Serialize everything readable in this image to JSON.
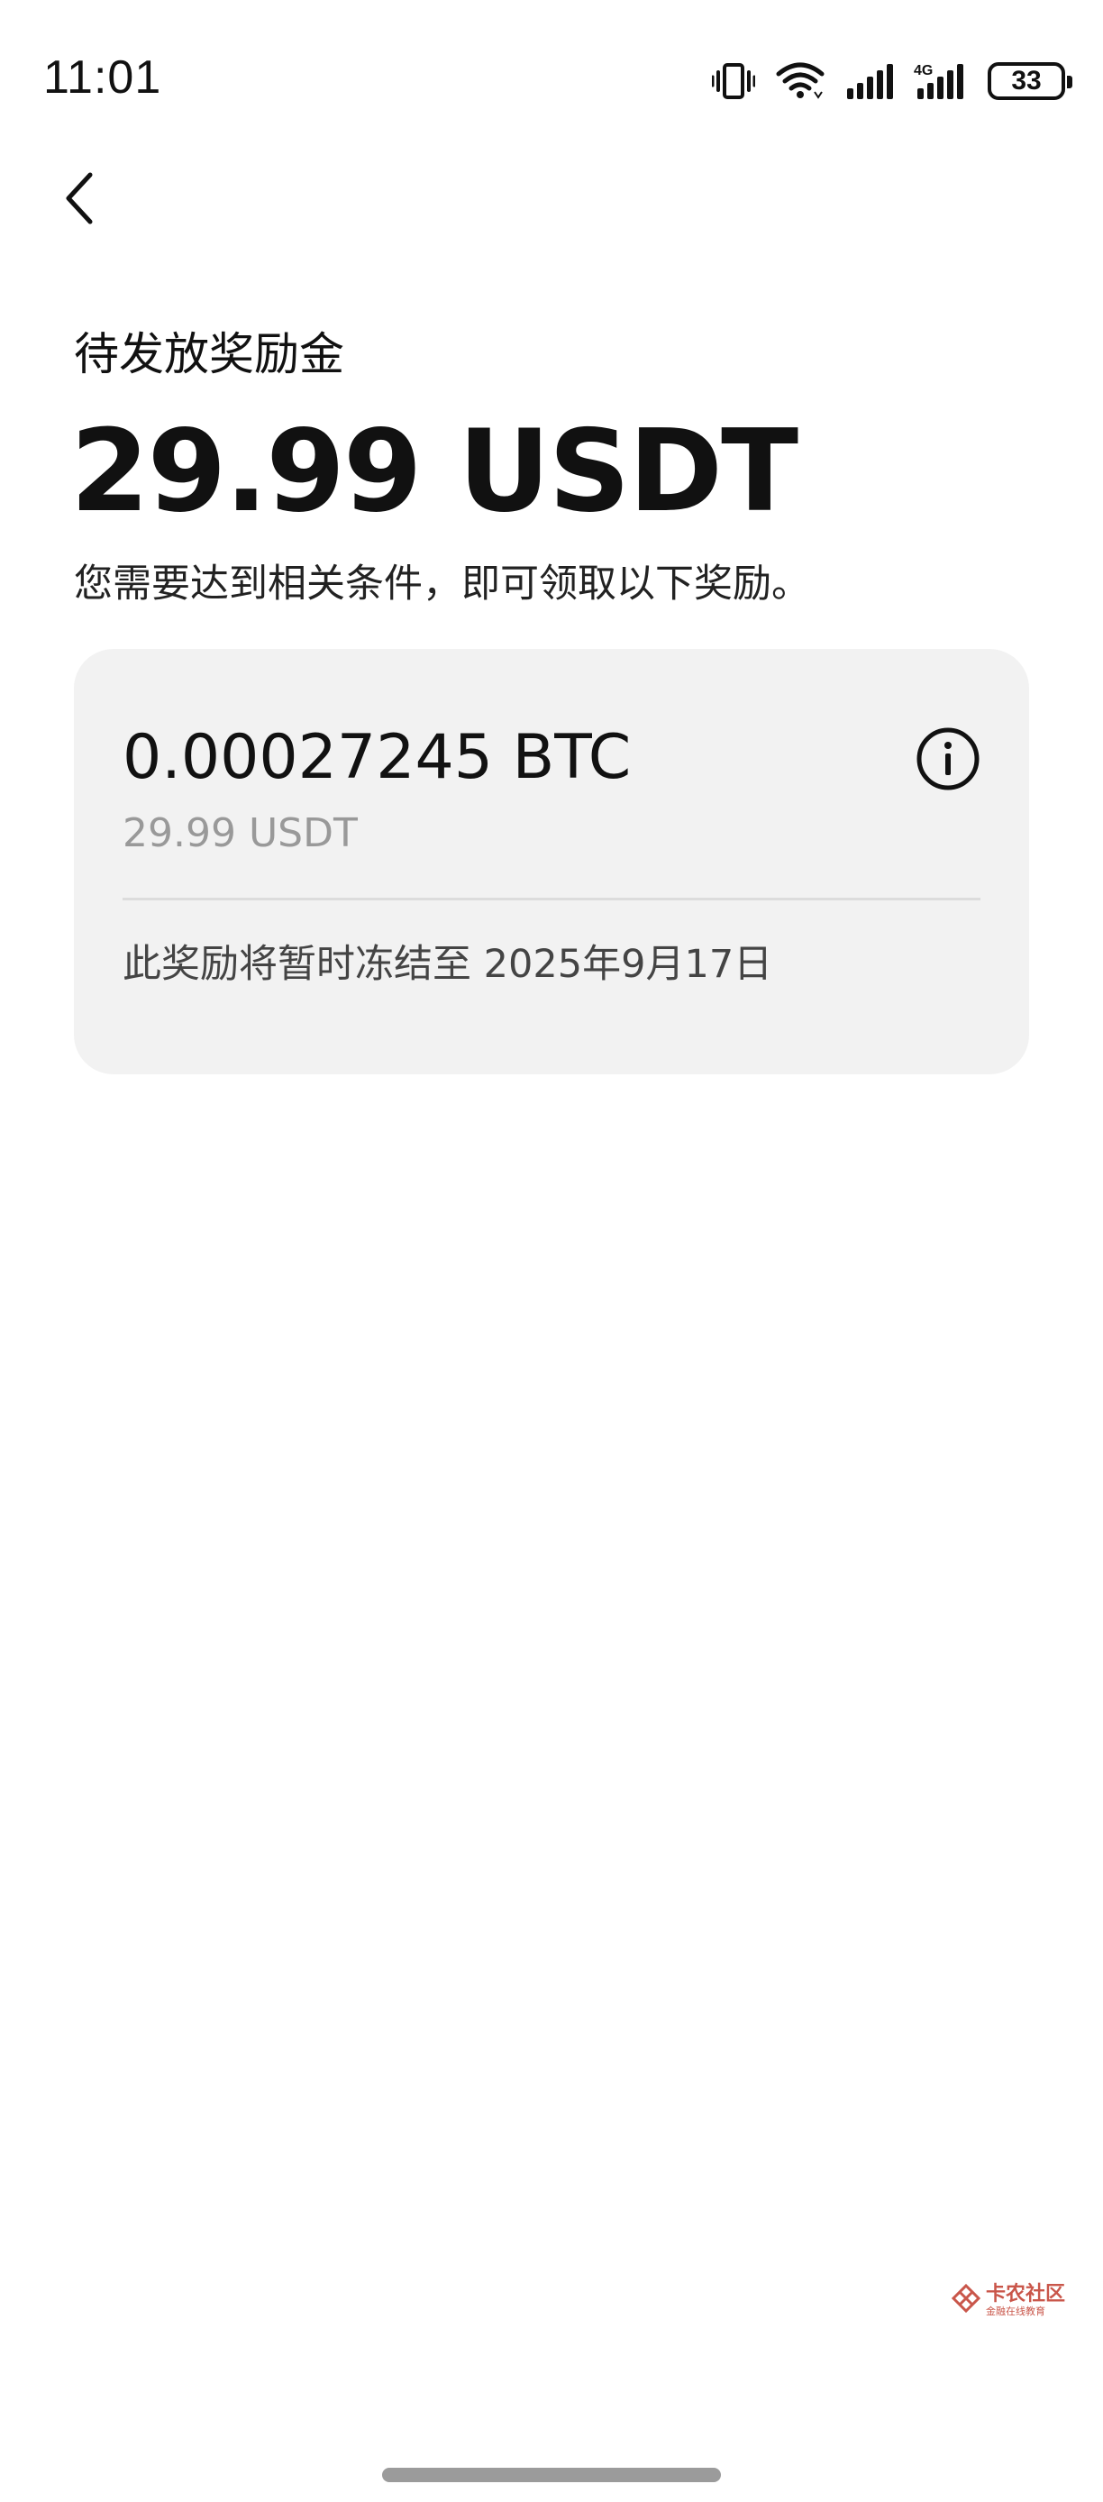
{
  "status_bar": {
    "time": "11:01",
    "battery_level": "33",
    "network_label": "4G",
    "icons": [
      "vibrate-icon",
      "wifi-icon",
      "signal-icon",
      "signal-4g-icon",
      "battery-icon"
    ]
  },
  "nav": {
    "back_icon": "chevron-left-icon"
  },
  "header": {
    "subtitle": "待发放奖励金",
    "amount": "29.99 USDT",
    "description": "您需要达到相关条件，即可领取以下奖励。"
  },
  "reward_card": {
    "crypto_amount": "0.00027245 BTC",
    "usdt_equivalent": "29.99 USDT",
    "info_icon": "info-icon",
    "freeze_note": "此奖励将暂时冻结至 2025年9月17日"
  },
  "watermark": {
    "title": "卡农社区",
    "subtitle": "金融在线教育",
    "accent_color": "#c0392b"
  },
  "colors": {
    "background": "#ffffff",
    "card_background": "#f2f2f2",
    "primary_text": "#111111",
    "secondary_text": "#999999"
  }
}
